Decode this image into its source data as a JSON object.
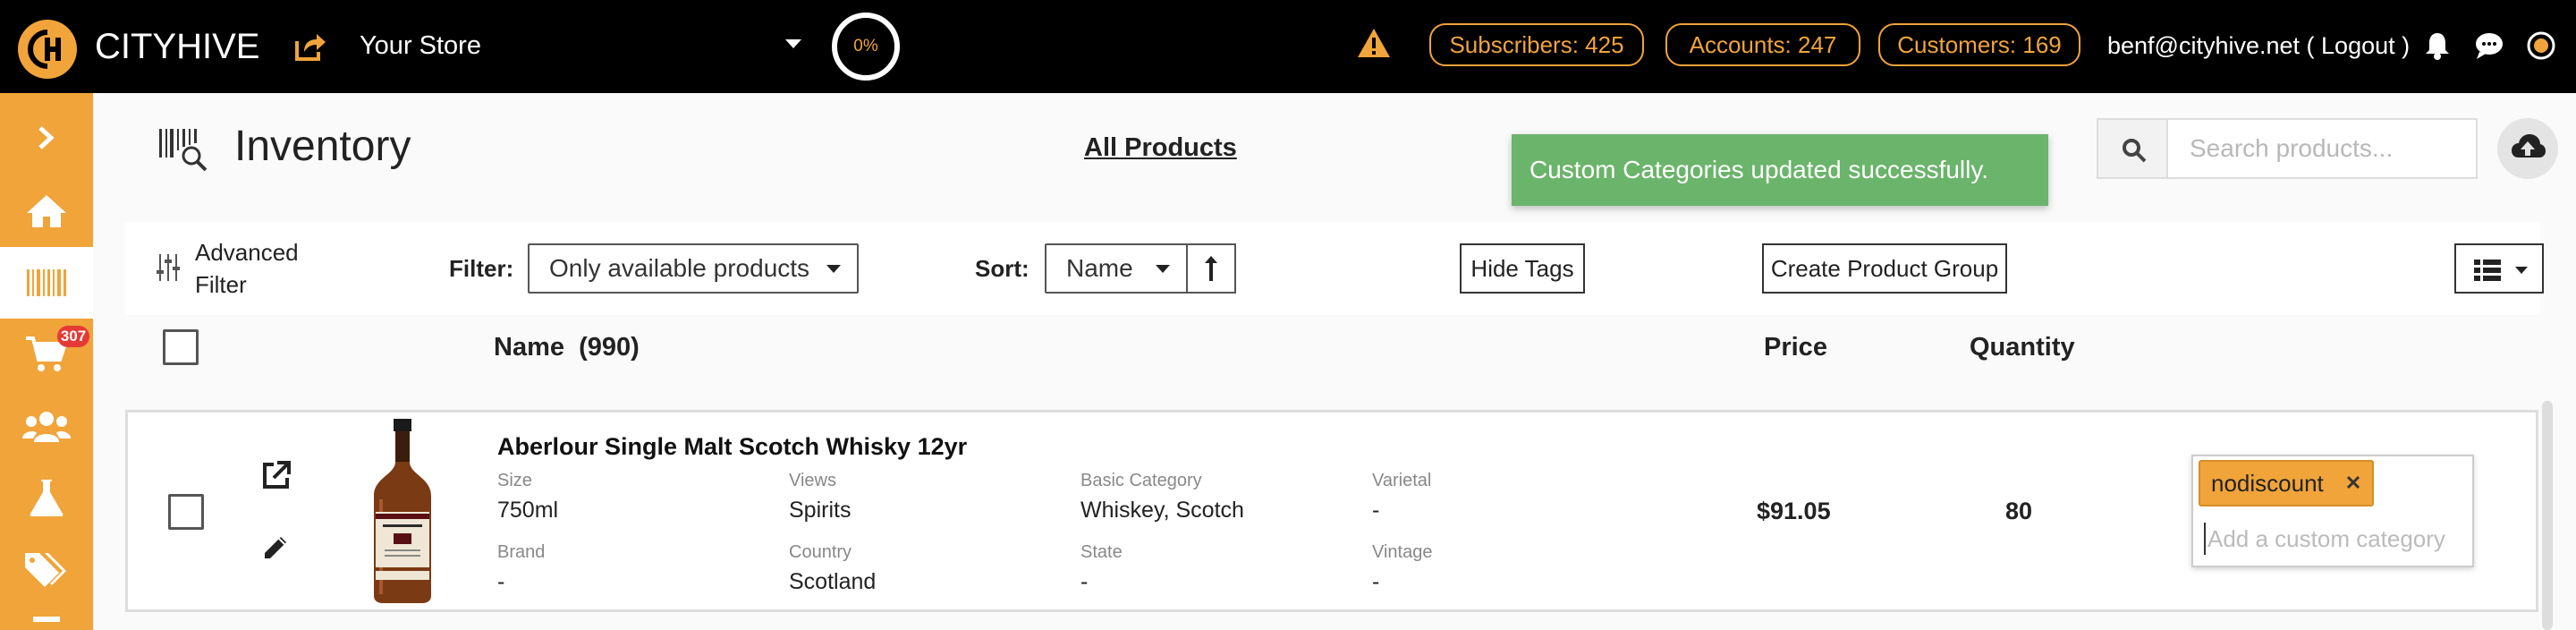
{
  "topbar": {
    "brand": "CITYHIVE",
    "store": "Your Store",
    "progress": "0%",
    "progress_value": 0,
    "subscribers": "Subscribers: 425",
    "accounts": "Accounts: 247",
    "customers": "Customers: 169",
    "user_email": "benf@cityhive.net",
    "logout_open": " ( ",
    "logout": "Logout",
    "logout_close": " )",
    "accent_color": "#f0a43a"
  },
  "sidebar": {
    "items": [
      {
        "icon": "chevron-right-icon"
      },
      {
        "icon": "home-icon"
      },
      {
        "icon": "barcode-icon",
        "active": true
      },
      {
        "icon": "cart-icon",
        "badge": "307"
      },
      {
        "icon": "users-icon"
      },
      {
        "icon": "flask-icon"
      },
      {
        "icon": "tags-icon"
      }
    ]
  },
  "page": {
    "title": "Inventory",
    "all_products": "All Products",
    "toast": "Custom Categories updated successfully.",
    "search_placeholder": "Search products...",
    "toast_color": "#6bb46b"
  },
  "toolbar": {
    "advanced_filter_line1": "Advanced",
    "advanced_filter_line2": "Filter",
    "filter_label": "Filter:",
    "filter_value": "Only available products",
    "sort_label": "Sort:",
    "sort_value": "Name",
    "hide_tags": "Hide Tags",
    "create_group": "Create Product Group"
  },
  "table": {
    "name_header": "Name",
    "count": "(990)",
    "price_header": "Price",
    "qty_header": "Quantity",
    "rows": [
      {
        "name": "Aberlour Single Malt Scotch Whisky 12yr",
        "size_label": "Size",
        "size": "750ml",
        "views_label": "Views",
        "views": "Spirits",
        "basic_category_label": "Basic Category",
        "basic_category": "Whiskey, Scotch",
        "varietal_label": "Varietal",
        "varietal": "-",
        "brand_label": "Brand",
        "brand": "-",
        "country_label": "Country",
        "country": "Scotland",
        "state_label": "State",
        "state": "-",
        "vintage_label": "Vintage",
        "vintage": "-",
        "price": "$91.05",
        "quantity": "80",
        "tags": [
          "nodiscount"
        ],
        "tag_placeholder": "Add a custom category"
      }
    ]
  }
}
